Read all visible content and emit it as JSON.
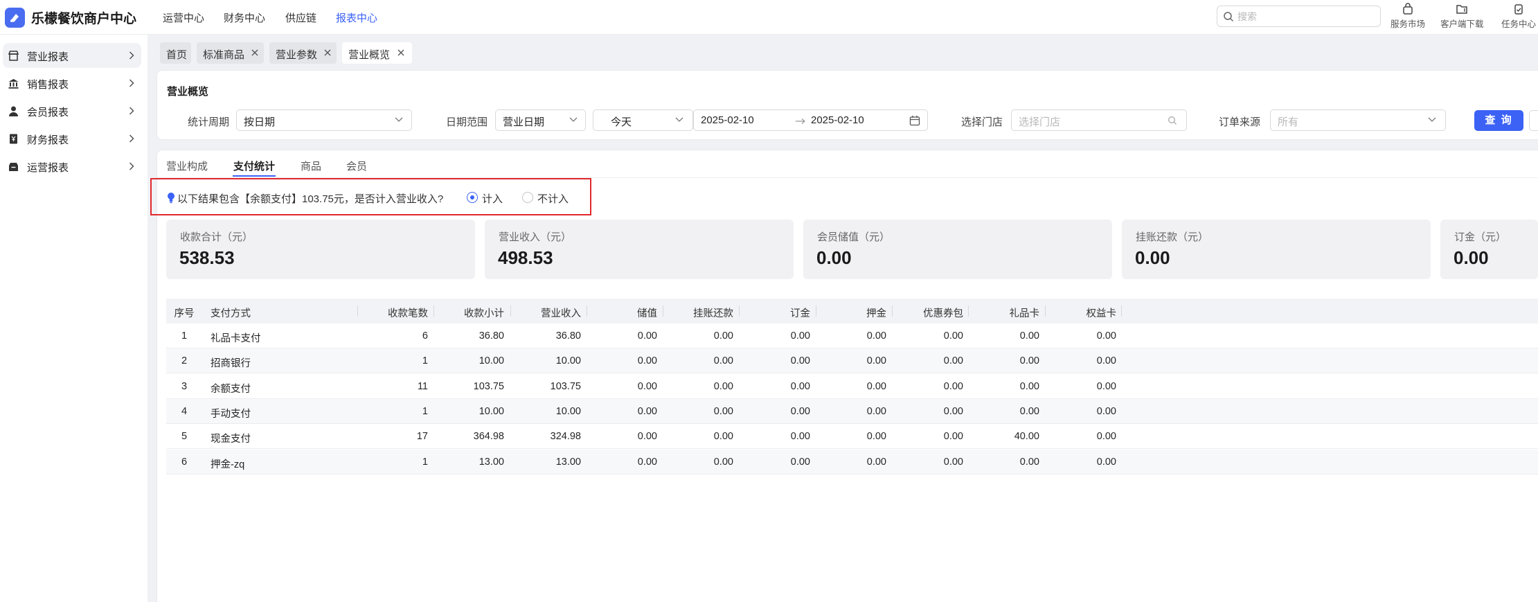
{
  "app": {
    "name": "乐檬餐饮商户中心"
  },
  "topnav": [
    {
      "label": "运营中心"
    },
    {
      "label": "财务中心"
    },
    {
      "label": "供应链"
    },
    {
      "label": "报表中心"
    }
  ],
  "search": {
    "placeholder": "搜索"
  },
  "tools": [
    {
      "label": "服务市场",
      "icon": "store-icon"
    },
    {
      "label": "客户端下载",
      "icon": "download-icon"
    },
    {
      "label": "任务中心",
      "icon": "task-icon"
    }
  ],
  "sidebar": {
    "items": [
      {
        "label": "营业报表",
        "icon": "shop-icon"
      },
      {
        "label": "销售报表",
        "icon": "bank-icon"
      },
      {
        "label": "会员报表",
        "icon": "user-icon"
      },
      {
        "label": "财务报表",
        "icon": "finance-icon"
      },
      {
        "label": "运营报表",
        "icon": "box-icon"
      }
    ]
  },
  "tabs": [
    {
      "label": "首页"
    },
    {
      "label": "标准商品"
    },
    {
      "label": "营业参数"
    },
    {
      "label": "营业概览"
    }
  ],
  "filters": {
    "title": "营业概览",
    "period_label": "统计周期",
    "period_value": "按日期",
    "range_label": "日期范围",
    "range_type": "营业日期",
    "quick_range": "今天",
    "start_date": "2025-02-10",
    "end_date": "2025-02-10",
    "store_label": "选择门店",
    "store_placeholder": "选择门店",
    "source_label": "订单来源",
    "source_value": "所有",
    "query_button": "查 询"
  },
  "content_tabs": [
    {
      "label": "营业构成"
    },
    {
      "label": "支付统计"
    },
    {
      "label": "商品"
    },
    {
      "label": "会员"
    }
  ],
  "notice": {
    "text": "以下结果包含【余额支付】103.75元，是否计入营业收入?",
    "options": [
      {
        "label": "计入",
        "selected": true
      },
      {
        "label": "不计入",
        "selected": false
      }
    ]
  },
  "stats": [
    {
      "label": "收款合计（元）",
      "value": "538.53"
    },
    {
      "label": "营业收入（元）",
      "value": "498.53"
    },
    {
      "label": "会员储值（元）",
      "value": "0.00"
    },
    {
      "label": "挂账还款（元）",
      "value": "0.00"
    },
    {
      "label": "订金（元）",
      "value": "0.00"
    }
  ],
  "table": {
    "columns": [
      "序号",
      "支付方式",
      "收款笔数",
      "收款小计",
      "营业收入",
      "储值",
      "挂账还款",
      "订金",
      "押金",
      "优惠券包",
      "礼品卡",
      "权益卡"
    ],
    "rows": [
      [
        "1",
        "礼品卡支付",
        "6",
        "36.80",
        "36.80",
        "0.00",
        "0.00",
        "0.00",
        "0.00",
        "0.00",
        "0.00",
        "0.00"
      ],
      [
        "2",
        "招商银行",
        "1",
        "10.00",
        "10.00",
        "0.00",
        "0.00",
        "0.00",
        "0.00",
        "0.00",
        "0.00",
        "0.00"
      ],
      [
        "3",
        "余额支付",
        "11",
        "103.75",
        "103.75",
        "0.00",
        "0.00",
        "0.00",
        "0.00",
        "0.00",
        "0.00",
        "0.00"
      ],
      [
        "4",
        "手动支付",
        "1",
        "10.00",
        "10.00",
        "0.00",
        "0.00",
        "0.00",
        "0.00",
        "0.00",
        "0.00",
        "0.00"
      ],
      [
        "5",
        "现金支付",
        "17",
        "364.98",
        "324.98",
        "0.00",
        "0.00",
        "0.00",
        "0.00",
        "0.00",
        "40.00",
        "0.00"
      ],
      [
        "6",
        "押金-zq",
        "1",
        "13.00",
        "13.00",
        "0.00",
        "0.00",
        "0.00",
        "0.00",
        "0.00",
        "0.00",
        "0.00"
      ]
    ]
  },
  "colors": {
    "accent": "#3b62f5",
    "highlight_border": "#e0282d"
  }
}
